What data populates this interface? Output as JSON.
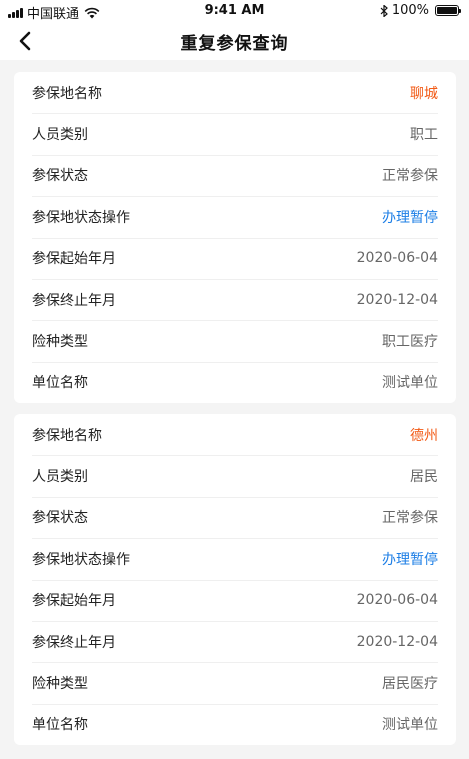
{
  "status_bar": {
    "carrier": "中国联通",
    "time": "9:41 AM",
    "battery_text": "100%"
  },
  "nav": {
    "title": "重复参保查询",
    "back_icon": "chevron-left-icon"
  },
  "records": [
    {
      "rows": [
        {
          "label": "参保地名称",
          "value": "聊城",
          "color": "#f25a16"
        },
        {
          "label": "人员类别",
          "value": "职工"
        },
        {
          "label": "参保状态",
          "value": "正常参保"
        },
        {
          "label": "参保地状态操作",
          "value": "办理暂停",
          "color": "#1e7fe6"
        },
        {
          "label": "参保起始年月",
          "value": "2020-06-04"
        },
        {
          "label": "参保终止年月",
          "value": "2020-12-04"
        },
        {
          "label": "险种类型",
          "value": "职工医疗"
        },
        {
          "label": "单位名称",
          "value": "测试单位"
        }
      ]
    },
    {
      "rows": [
        {
          "label": "参保地名称",
          "value": "德州",
          "color": "#f25a16"
        },
        {
          "label": "人员类别",
          "value": "居民"
        },
        {
          "label": "参保状态",
          "value": "正常参保"
        },
        {
          "label": "参保地状态操作",
          "value": "办理暂停",
          "color": "#1e7fe6"
        },
        {
          "label": "参保起始年月",
          "value": "2020-06-04"
        },
        {
          "label": "参保终止年月",
          "value": "2020-12-04"
        },
        {
          "label": "险种类型",
          "value": "居民医疗"
        },
        {
          "label": "单位名称",
          "value": "测试单位"
        }
      ]
    }
  ]
}
